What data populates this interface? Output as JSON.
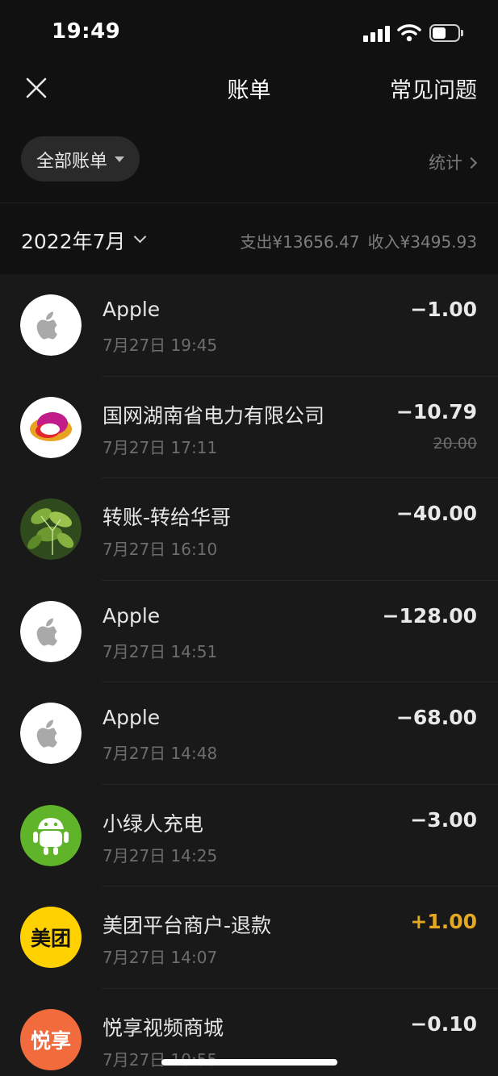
{
  "status_bar": {
    "time": "19:49"
  },
  "nav": {
    "title": "账单",
    "faq_label": "常见问题"
  },
  "filter": {
    "label": "全部账单",
    "stats_label": "统计"
  },
  "month": {
    "label": "2022年7月",
    "expense": "支出¥13656.47",
    "income": "收入¥3495.93"
  },
  "transactions": [
    {
      "name": "Apple",
      "time": "7月27日 19:45",
      "amount": "−1.00",
      "icon": "apple-icon"
    },
    {
      "name": "国网湖南省电力有限公司",
      "time": "7月27日 17:11",
      "amount": "−10.79",
      "original_amount": "20.00",
      "icon": "state-grid-logo"
    },
    {
      "name": "转账-转给华哥",
      "time": "7月27日 16:10",
      "amount": "−40.00",
      "icon": "user-avatar-plant"
    },
    {
      "name": "Apple",
      "time": "7月27日 14:51",
      "amount": "−128.00",
      "icon": "apple-icon"
    },
    {
      "name": "Apple",
      "time": "7月27日 14:48",
      "amount": "−68.00",
      "icon": "apple-icon"
    },
    {
      "name": "小绿人充电",
      "time": "7月27日 14:25",
      "amount": "−3.00",
      "icon": "green-robot-logo"
    },
    {
      "name": "美团平台商户-退款",
      "time": "7月27日 14:07",
      "amount": "+1.00",
      "icon": "meituan-logo",
      "logo_text": "美团"
    },
    {
      "name": "悦享视频商城",
      "time": "7月27日 10:55",
      "amount": "−0.10",
      "icon": "yuexiang-logo",
      "logo_text": "悦享"
    }
  ],
  "colors": {
    "background": "#191919",
    "header": "#111111",
    "income": "#e5a823"
  }
}
